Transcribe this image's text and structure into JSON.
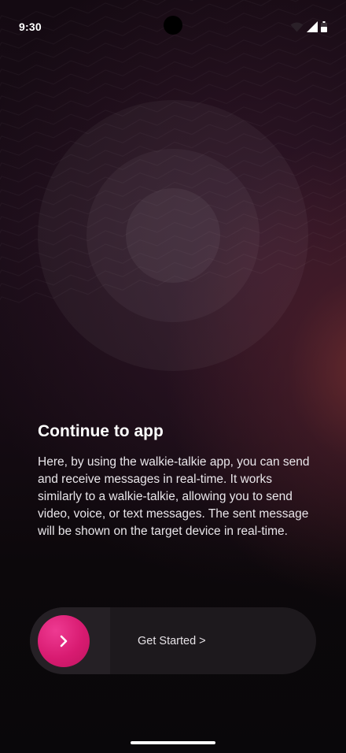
{
  "status_bar": {
    "time": "9:30",
    "icons": [
      "wifi-icon",
      "cellular-signal-icon",
      "battery-icon"
    ]
  },
  "onboarding": {
    "title": "Continue to app",
    "description": "Here, by using the walkie-talkie app, you can send and receive messages in real-time. It works similarly to a walkie-talkie, allowing you to send video, voice, or text messages. The sent message will be shown on the target device in real-time."
  },
  "slider": {
    "label": "Get Started >",
    "knob_icon": "chevron-right-icon",
    "knob_color": "#d81b71"
  },
  "colors": {
    "background": "#0a070b",
    "accent": "#d81b71",
    "glow": "#7d3232"
  }
}
